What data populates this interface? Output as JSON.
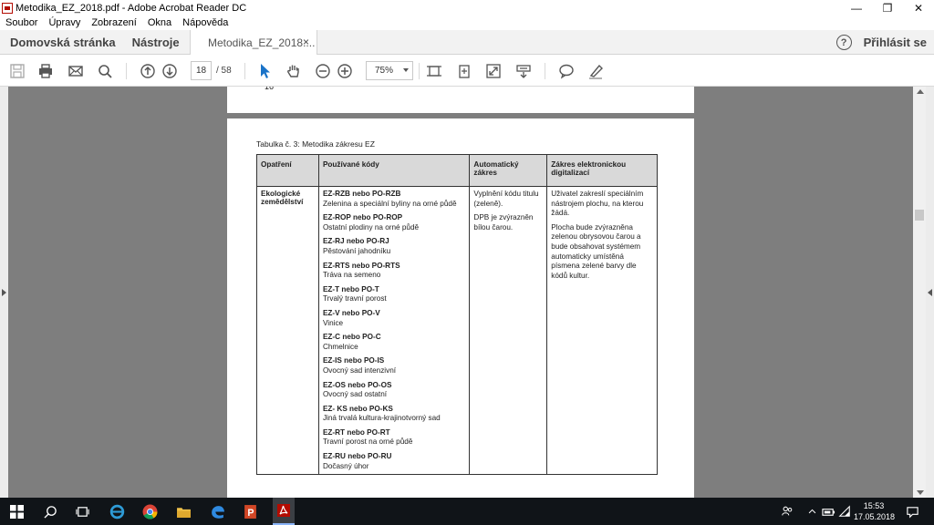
{
  "window": {
    "title": "Metodika_EZ_2018.pdf - Adobe Acrobat Reader DC",
    "minimize_glyph": "—",
    "maximize_glyph": "❐",
    "close_glyph": "✕"
  },
  "menu": [
    "Soubor",
    "Úpravy",
    "Zobrazení",
    "Okna",
    "Nápověda"
  ],
  "tabs": {
    "home": "Domovská stránka",
    "tools": "Nástroje",
    "document": "Metodika_EZ_2018....",
    "document_close": "×",
    "help": "?",
    "signin": "Přihlásit se"
  },
  "toolbar": {
    "page_current": "18",
    "page_total": "/ 58",
    "zoom": "75%"
  },
  "document": {
    "prev_page_number": "16",
    "table_caption": "Tabulka č. 3: Metodika zákresu EZ",
    "headers": [
      "Opatření",
      "Používané kódy",
      "Automatický zákres",
      "Zákres elektronickou digitalizací"
    ],
    "opatreni": "Ekologické zemědělství",
    "codes": [
      {
        "code": "EZ-RZB nebo PO-RZB",
        "desc": "Zelenina a speciální byliny na orné půdě"
      },
      {
        "code": "EZ-ROP nebo PO-ROP",
        "desc": "Ostatní plodiny na orné půdě"
      },
      {
        "code": "EZ-RJ nebo PO-RJ",
        "desc": "Pěstování jahodníku"
      },
      {
        "code": "EZ-RTS nebo PO-RTS",
        "desc": "Tráva na semeno"
      },
      {
        "code": "EZ-T nebo PO-T",
        "desc": "Trvalý travní porost"
      },
      {
        "code": "EZ-V nebo PO-V",
        "desc": "Vinice"
      },
      {
        "code": "EZ-C nebo PO-C",
        "desc": "Chmelnice"
      },
      {
        "code": "EZ-IS nebo PO-IS",
        "desc": "Ovocný sad intenzivní"
      },
      {
        "code": "EZ-OS nebo PO-OS",
        "desc": "Ovocný sad ostatní"
      },
      {
        "code": "EZ- KS nebo PO-KS",
        "desc": "Jiná trvalá kultura-krajinotvorný sad"
      },
      {
        "code": "EZ-RT nebo PO-RT",
        "desc": "Travní porost na orné půdě"
      },
      {
        "code": "EZ-RU nebo PO-RU",
        "desc": "Dočasný úhor"
      }
    ],
    "auto": [
      "Vyplnění kódu titulu (zeleně).",
      "DPB je zvýrazněn bílou čarou."
    ],
    "digital": [
      "Uživatel zakreslí speciálním nástrojem plochu, na kterou žádá.",
      "Plocha bude zvýrazněna zelenou obrysovou čarou a bude obsahovat systémem automaticky umístěná písmena zelené barvy dle kódů kultur."
    ]
  },
  "taskbar": {
    "time": "15:53",
    "date": "17.05.2018"
  },
  "colors": {
    "acrobat_red": "#b30b00",
    "select_blue": "#1a73c8",
    "doc_background": "#7e7e7e",
    "header_gray": "#d9d9d9"
  }
}
